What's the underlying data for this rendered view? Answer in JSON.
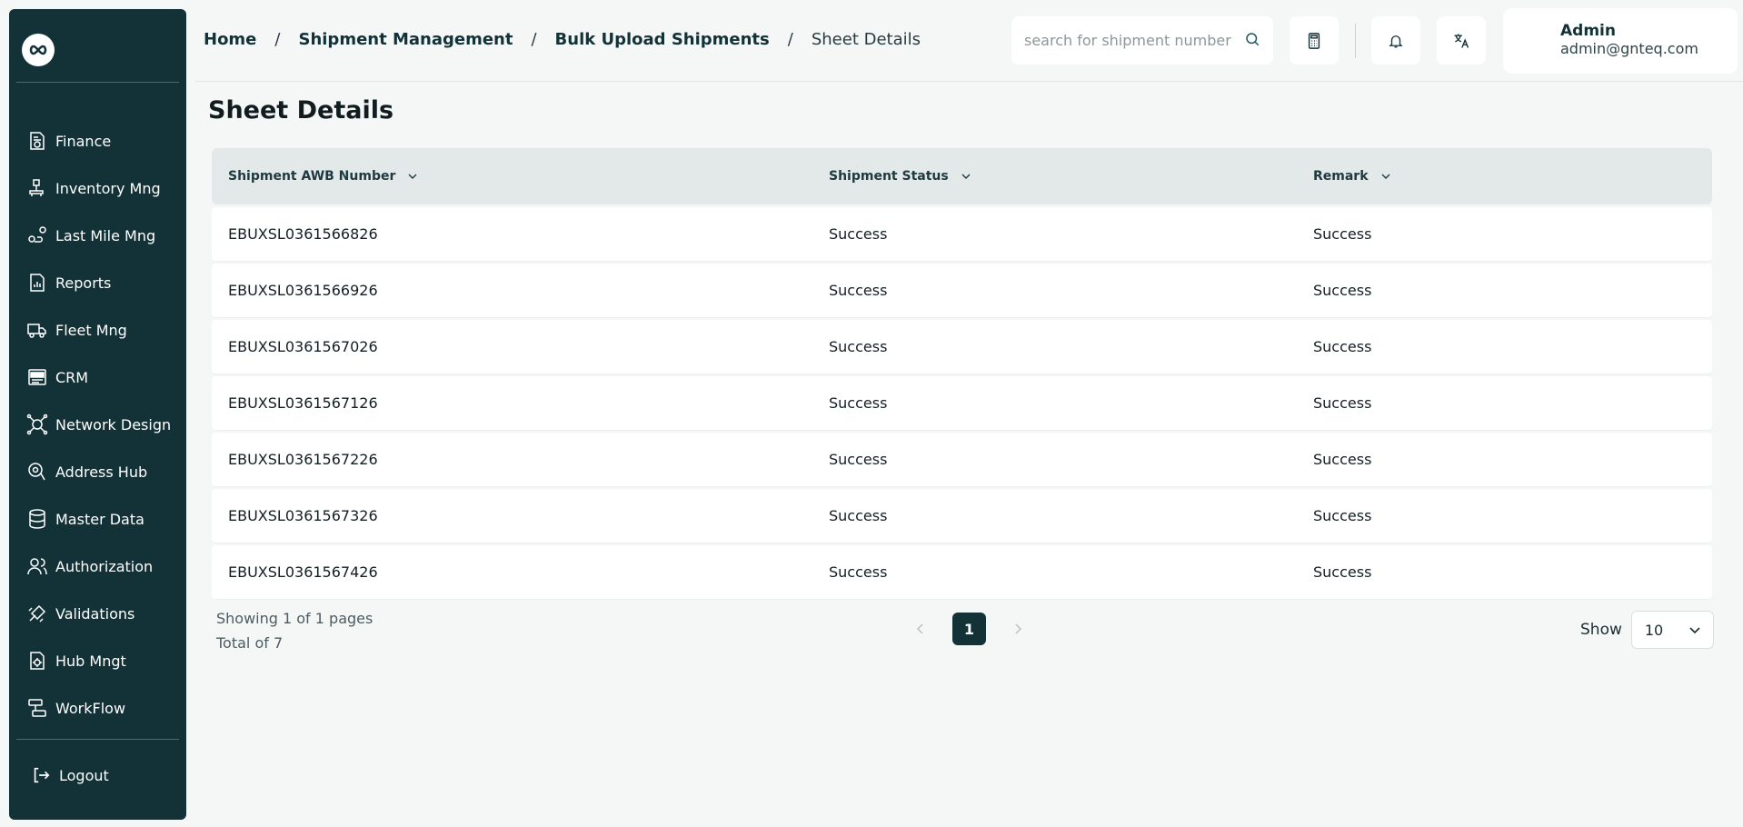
{
  "sidebar": {
    "logo_icon": "infinity-logo",
    "items": [
      {
        "label": "Finance",
        "icon": "finance-icon"
      },
      {
        "label": "Inventory Mng",
        "icon": "inventory-icon"
      },
      {
        "label": "Last Mile Mng",
        "icon": "last-mile-icon"
      },
      {
        "label": "Reports",
        "icon": "reports-icon"
      },
      {
        "label": "Fleet Mng",
        "icon": "truck-icon"
      },
      {
        "label": "CRM",
        "icon": "crm-icon"
      },
      {
        "label": "Network Design",
        "icon": "network-icon"
      },
      {
        "label": "Address Hub",
        "icon": "address-pin-icon"
      },
      {
        "label": "Master Data",
        "icon": "database-icon"
      },
      {
        "label": "Authorization",
        "icon": "users-icon"
      },
      {
        "label": "Validations",
        "icon": "validations-icon"
      },
      {
        "label": "Hub Mngt",
        "icon": "hub-settings-icon"
      },
      {
        "label": "WorkFlow",
        "icon": "workflow-icon"
      }
    ],
    "logout_label": "Logout"
  },
  "header": {
    "breadcrumb": [
      "Home",
      "Shipment Management",
      "Bulk Upload Shipments",
      "Sheet Details"
    ],
    "breadcrumb_sep": "/",
    "search_placeholder": "search for shipment number",
    "user_name": "Admin",
    "user_email": "admin@gnteq.com"
  },
  "main": {
    "title": "Sheet Details",
    "columns": [
      "Shipment AWB Number",
      "Shipment Status",
      "Remark"
    ],
    "rows": [
      [
        "EBUXSL0361566826",
        "Success",
        "Success"
      ],
      [
        "EBUXSL0361566926",
        "Success",
        "Success"
      ],
      [
        "EBUXSL0361567026",
        "Success",
        "Success"
      ],
      [
        "EBUXSL0361567126",
        "Success",
        "Success"
      ],
      [
        "EBUXSL0361567226",
        "Success",
        "Success"
      ],
      [
        "EBUXSL0361567326",
        "Success",
        "Success"
      ],
      [
        "EBUXSL0361567426",
        "Success",
        "Success"
      ]
    ],
    "pagination": {
      "showing": "Showing 1 of 1 pages",
      "total": "Total of 7",
      "current_page": "1",
      "show_label": "Show",
      "page_size": "10"
    }
  },
  "colors": {
    "sidebar_bg": "#123238",
    "accent": "#123238",
    "page_bg": "#f5f7f7",
    "table_header_bg": "#e3e8e9"
  }
}
